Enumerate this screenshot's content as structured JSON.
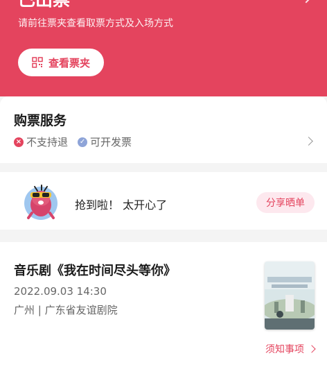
{
  "banner": {
    "title": "已出票",
    "description": "请前往票夹查看取票方式及入场方式",
    "button_label": "查看票夹",
    "bg_color": "#e4445e"
  },
  "service": {
    "title": "购票服务",
    "items": [
      {
        "label": "不支持退",
        "icon": "close-circle-icon"
      },
      {
        "label": "可开发票",
        "icon": "check-circle-icon"
      }
    ]
  },
  "share": {
    "text": "抢到啦！ 太开心了",
    "button_label": "分享晒单"
  },
  "show": {
    "title": "音乐剧《我在时间尽头等你》",
    "datetime": "2022.09.03 14:30",
    "venue": "广州 | 广东省友谊剧院",
    "notice_label": "须知事项"
  }
}
